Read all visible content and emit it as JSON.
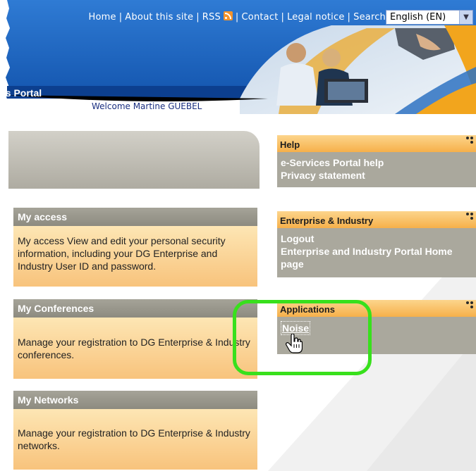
{
  "header": {
    "nav": [
      "Home",
      "About this site",
      "RSS",
      "Contact",
      "Legal notice",
      "Search"
    ],
    "language": "English (EN)",
    "portal_title": "es Portal",
    "welcome": "Welcome Martine GUEBEL"
  },
  "left_cards": [
    {
      "title": "My access",
      "body": "My access View and edit your personal security information, including your DG Enterprise and Industry User ID and password."
    },
    {
      "title": "My Conferences",
      "body": "Manage your registration to DG Enterprise & Industry conferences."
    },
    {
      "title": "My Networks",
      "body": "Manage your registration to DG Enterprise & Industry networks."
    }
  ],
  "right_panels": {
    "help": {
      "title": "Help",
      "links": [
        "e-Services Portal help",
        "Privacy statement"
      ]
    },
    "enterprise": {
      "title": "Enterprise & Industry",
      "links": [
        "Logout",
        "Enterprise and Industry Portal Home page"
      ]
    },
    "applications": {
      "title": "Applications",
      "links": [
        "Noise"
      ]
    }
  },
  "colors": {
    "highlight": "#38e01c",
    "header_blue": "#1d5fb5",
    "panel_orange": "#f6b04a"
  }
}
